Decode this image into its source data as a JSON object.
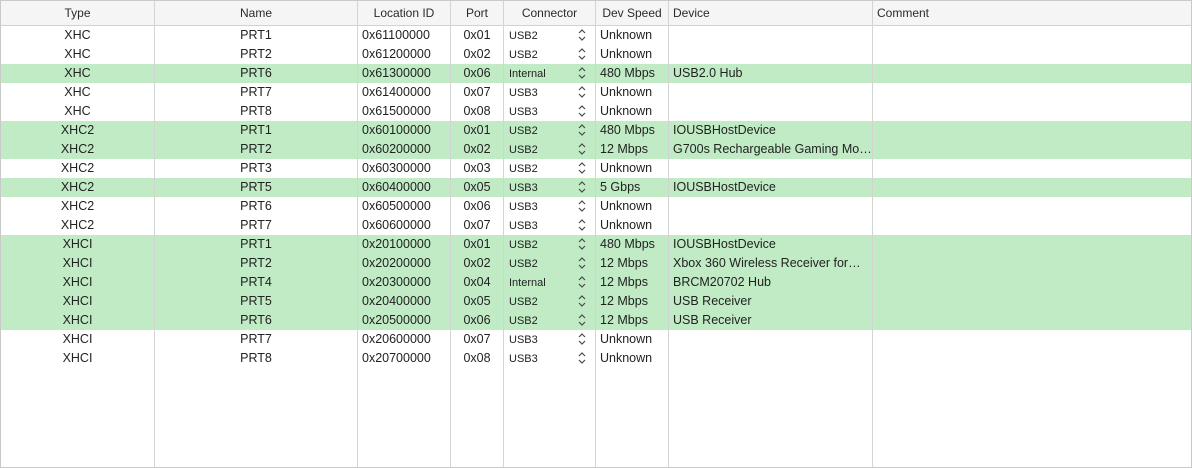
{
  "columns": {
    "type": "Type",
    "name": "Name",
    "location_id": "Location ID",
    "port": "Port",
    "connector": "Connector",
    "dev_speed": "Dev Speed",
    "device": "Device",
    "comment": "Comment"
  },
  "colors": {
    "active_row": "#c0ebc4",
    "header_bg": "#f5f5f5",
    "grid_line": "#d4d4d4"
  },
  "stepper_icon": "up-down-chevron-icon",
  "rows": [
    {
      "type": "XHC",
      "name": "PRT1",
      "location": "0x61100000",
      "port": "0x01",
      "connector": "USB2",
      "speed": "Unknown",
      "device": "",
      "comment": "",
      "active": false
    },
    {
      "type": "XHC",
      "name": "PRT2",
      "location": "0x61200000",
      "port": "0x02",
      "connector": "USB2",
      "speed": "Unknown",
      "device": "",
      "comment": "",
      "active": false
    },
    {
      "type": "XHC",
      "name": "PRT6",
      "location": "0x61300000",
      "port": "0x06",
      "connector": "Internal",
      "speed": "480 Mbps",
      "device": "USB2.0 Hub",
      "comment": "",
      "active": true
    },
    {
      "type": "XHC",
      "name": "PRT7",
      "location": "0x61400000",
      "port": "0x07",
      "connector": "USB3",
      "speed": "Unknown",
      "device": "",
      "comment": "",
      "active": false
    },
    {
      "type": "XHC",
      "name": "PRT8",
      "location": "0x61500000",
      "port": "0x08",
      "connector": "USB3",
      "speed": "Unknown",
      "device": "",
      "comment": "",
      "active": false
    },
    {
      "type": "XHC2",
      "name": "PRT1",
      "location": "0x60100000",
      "port": "0x01",
      "connector": "USB2",
      "speed": "480 Mbps",
      "device": "IOUSBHostDevice",
      "comment": "",
      "active": true
    },
    {
      "type": "XHC2",
      "name": "PRT2",
      "location": "0x60200000",
      "port": "0x02",
      "connector": "USB2",
      "speed": "12 Mbps",
      "device": "G700s Rechargeable Gaming Mo…",
      "comment": "",
      "active": true
    },
    {
      "type": "XHC2",
      "name": "PRT3",
      "location": "0x60300000",
      "port": "0x03",
      "connector": "USB2",
      "speed": "Unknown",
      "device": "",
      "comment": "",
      "active": false
    },
    {
      "type": "XHC2",
      "name": "PRT5",
      "location": "0x60400000",
      "port": "0x05",
      "connector": "USB3",
      "speed": "5 Gbps",
      "device": "IOUSBHostDevice",
      "comment": "",
      "active": true
    },
    {
      "type": "XHC2",
      "name": "PRT6",
      "location": "0x60500000",
      "port": "0x06",
      "connector": "USB3",
      "speed": "Unknown",
      "device": "",
      "comment": "",
      "active": false
    },
    {
      "type": "XHC2",
      "name": "PRT7",
      "location": "0x60600000",
      "port": "0x07",
      "connector": "USB3",
      "speed": "Unknown",
      "device": "",
      "comment": "",
      "active": false
    },
    {
      "type": "XHCI",
      "name": "PRT1",
      "location": "0x20100000",
      "port": "0x01",
      "connector": "USB2",
      "speed": "480 Mbps",
      "device": "IOUSBHostDevice",
      "comment": "",
      "active": true
    },
    {
      "type": "XHCI",
      "name": "PRT2",
      "location": "0x20200000",
      "port": "0x02",
      "connector": "USB2",
      "speed": "12 Mbps",
      "device": "Xbox 360 Wireless Receiver for…",
      "comment": "",
      "active": true
    },
    {
      "type": "XHCI",
      "name": "PRT4",
      "location": "0x20300000",
      "port": "0x04",
      "connector": "Internal",
      "speed": "12 Mbps",
      "device": "BRCM20702 Hub",
      "comment": "",
      "active": true
    },
    {
      "type": "XHCI",
      "name": "PRT5",
      "location": "0x20400000",
      "port": "0x05",
      "connector": "USB2",
      "speed": "12 Mbps",
      "device": "USB Receiver",
      "comment": "",
      "active": true
    },
    {
      "type": "XHCI",
      "name": "PRT6",
      "location": "0x20500000",
      "port": "0x06",
      "connector": "USB2",
      "speed": "12 Mbps",
      "device": "USB Receiver",
      "comment": "",
      "active": true
    },
    {
      "type": "XHCI",
      "name": "PRT7",
      "location": "0x20600000",
      "port": "0x07",
      "connector": "USB3",
      "speed": "Unknown",
      "device": "",
      "comment": "",
      "active": false
    },
    {
      "type": "XHCI",
      "name": "PRT8",
      "location": "0x20700000",
      "port": "0x08",
      "connector": "USB3",
      "speed": "Unknown",
      "device": "",
      "comment": "",
      "active": false
    }
  ]
}
